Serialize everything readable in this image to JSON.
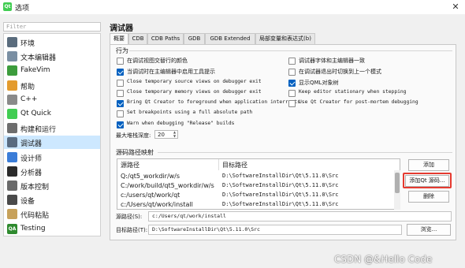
{
  "window": {
    "title": "选项",
    "app_icon": "Qt"
  },
  "filter": {
    "placeholder": "Filter"
  },
  "sidebar": {
    "items": [
      {
        "label": "环境",
        "icon": "monitor-icon",
        "color": "#5a6c7d"
      },
      {
        "label": "文本编辑器",
        "icon": "text-editor-icon",
        "color": "#7a8fa3"
      },
      {
        "label": "FakeVim",
        "icon": "fakevim-icon",
        "color": "#3c9c3c"
      },
      {
        "label": "帮助",
        "icon": "help-icon",
        "color": "#e39b2e"
      },
      {
        "label": "C++",
        "icon": "cpp-icon",
        "color": "#8a8a8a"
      },
      {
        "label": "Qt Quick",
        "icon": "qtquick-icon",
        "color": "#41cd52"
      },
      {
        "label": "构建和运行",
        "icon": "build-run-icon",
        "color": "#6d6d6d"
      },
      {
        "label": "调试器",
        "icon": "debugger-icon",
        "color": "#596b80"
      },
      {
        "label": "设计师",
        "icon": "designer-icon",
        "color": "#3b7dd8"
      },
      {
        "label": "分析器",
        "icon": "analyzer-icon",
        "color": "#2b2b2b"
      },
      {
        "label": "版本控制",
        "icon": "version-control-icon",
        "color": "#6a6a6a"
      },
      {
        "label": "设备",
        "icon": "devices-icon",
        "color": "#4a4a4a"
      },
      {
        "label": "代码粘贴",
        "icon": "code-paste-icon",
        "color": "#c7a15a"
      },
      {
        "label": "Testing",
        "icon": "testing-qa-icon",
        "color": "#2f8a2f",
        "badge": "QA"
      }
    ],
    "selected": "调试器"
  },
  "page": {
    "title": "调试器",
    "tabs": [
      "概要",
      "CDB",
      "CDB Paths",
      "GDB",
      "GDB Extended",
      "局部变量和表达式(b)"
    ],
    "active_tab": "概要"
  },
  "behavior": {
    "group_label": "行为",
    "left_options": [
      {
        "label": "在调试视图交替行的颜色",
        "checked": false
      },
      {
        "label": "当调试时在主编辑器中启用工具提示",
        "checked": true
      },
      {
        "label": "Close temporary source views on debugger exit",
        "checked": false
      },
      {
        "label": "Close temporary memory views on debugger exit",
        "checked": false
      },
      {
        "label": "Bring Qt Creator to foreground when application interrupts",
        "checked": true
      },
      {
        "label": "Set breakpoints using a full absolute path",
        "checked": false
      },
      {
        "label": "Warn when debugging \"Release\" builds",
        "checked": true
      }
    ],
    "right_options": [
      {
        "label": "调试器字体和主编辑器一致",
        "checked": false
      },
      {
        "label": "在调试器退出时切换到上一个模式",
        "checked": false
      },
      {
        "label": "显示QML对象树",
        "checked": true
      },
      {
        "label": "Keep editor stationary when stepping",
        "checked": false
      },
      {
        "label": "Use Qt Creator for post-mortem debugging",
        "checked": false
      }
    ],
    "stack_depth_label": "最大堆栈深度:",
    "stack_depth_value": "20"
  },
  "source_mapping": {
    "group_label": "源码路径映射",
    "columns": [
      "源路径",
      "目标路径"
    ],
    "rows": [
      {
        "source": "Q:/qt5_workdir/w/s",
        "target": "D:\\SoftwareInstallDir\\Qt\\5.11.0\\Src"
      },
      {
        "source": "C:/work/build/qt5_workdir/w/s",
        "target": "D:\\SoftwareInstallDir\\Qt\\5.11.0\\Src"
      },
      {
        "source": "c:/users/qt/work/qt",
        "target": "D:\\SoftwareInstallDir\\Qt\\5.11.0\\Src"
      },
      {
        "source": "c:/Users/qt/work/install",
        "target": "D:\\SoftwareInstallDir\\Qt\\5.11.0\\Src"
      }
    ],
    "buttons": {
      "add": "添加",
      "add_qt_sources": "添加Qt 源码...",
      "remove": "删除"
    },
    "source_path_label": "源路径(S):",
    "source_path_value": "c:/Users/qt/work/install",
    "target_path_label": "目标路径(T):",
    "target_path_value": "D:\\SoftwareInstallDir\\Qt\\5.11.0\\Src",
    "browse_button": "浏览..."
  },
  "watermark": "CSDN @&Hello Code",
  "colors": {
    "accent": "#0060c0",
    "selected_item": "#cde8ff",
    "highlight_box": "#e53a30"
  }
}
